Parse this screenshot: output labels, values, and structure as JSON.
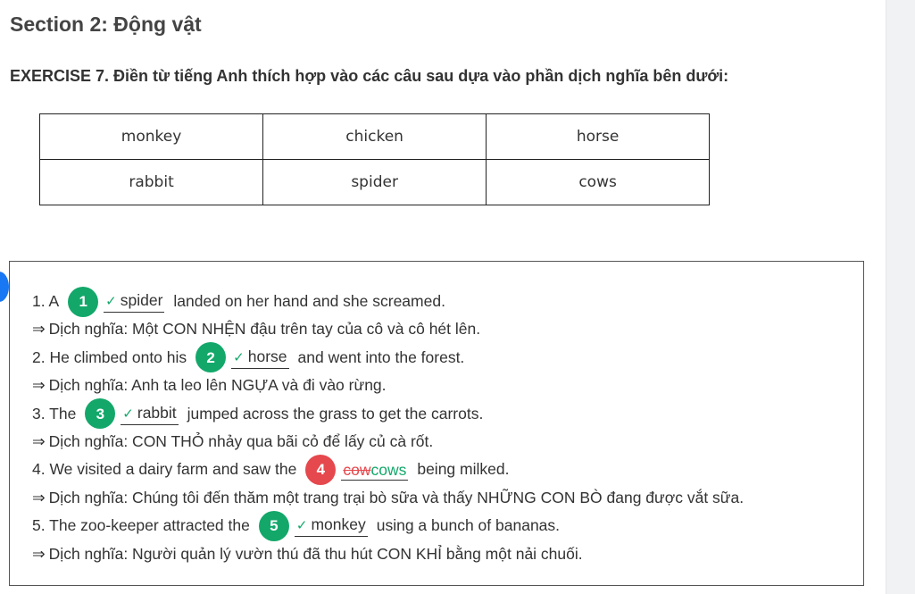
{
  "section_title": "Section 2: Động vật",
  "exercise_title": "EXERCISE 7. Điền từ tiếng Anh thích hợp vào các câu sau dựa vào phần dịch nghĩa bên dưới:",
  "word_table": {
    "rows": [
      [
        "monkey",
        "chicken",
        "horse"
      ],
      [
        "rabbit",
        "spider",
        "cows"
      ]
    ]
  },
  "questions": [
    {
      "num": "1",
      "before": "1. A",
      "answer": "spider",
      "status": "correct",
      "after": "landed on her hand and she screamed.",
      "translation": "Dịch nghĩa: Một CON NHỆN đậu trên tay của cô và cô hét lên."
    },
    {
      "num": "2",
      "before": "2. He climbed onto his",
      "answer": "horse",
      "status": "correct",
      "after": "and went into the forest.",
      "translation": "Dịch nghĩa: Anh ta leo lên NGỰA và đi vào rừng."
    },
    {
      "num": "3",
      "before": "3. The",
      "answer": "rabbit",
      "status": "correct",
      "after": "jumped across the grass to get the carrots.",
      "translation": "Dịch nghĩa: CON THỎ nhảy qua bãi cỏ để lấy củ cà rốt."
    },
    {
      "num": "4",
      "before": "4. We visited a dairy farm and saw the",
      "wrong_answer": "cow",
      "correct_answer": "cows",
      "status": "incorrect",
      "after": "being milked.",
      "translation": "Dịch nghĩa: Chúng tôi đến thăm một trang trại bò sữa và thấy NHỮNG CON BÒ đang được vắt sữa."
    },
    {
      "num": "5",
      "before": "5. The zoo-keeper attracted the",
      "answer": "monkey",
      "status": "correct",
      "after": "using a bunch of bananas.",
      "translation": "Dịch nghĩa: Người quản lý vườn thú đã thu hút CON KHỈ bằng một nải chuối."
    }
  ],
  "arrow_symbol": "⇒",
  "colors": {
    "correct": "#13a86a",
    "incorrect": "#e5484d",
    "marker": "#1877f2"
  },
  "icons": {
    "check": "check-icon"
  }
}
